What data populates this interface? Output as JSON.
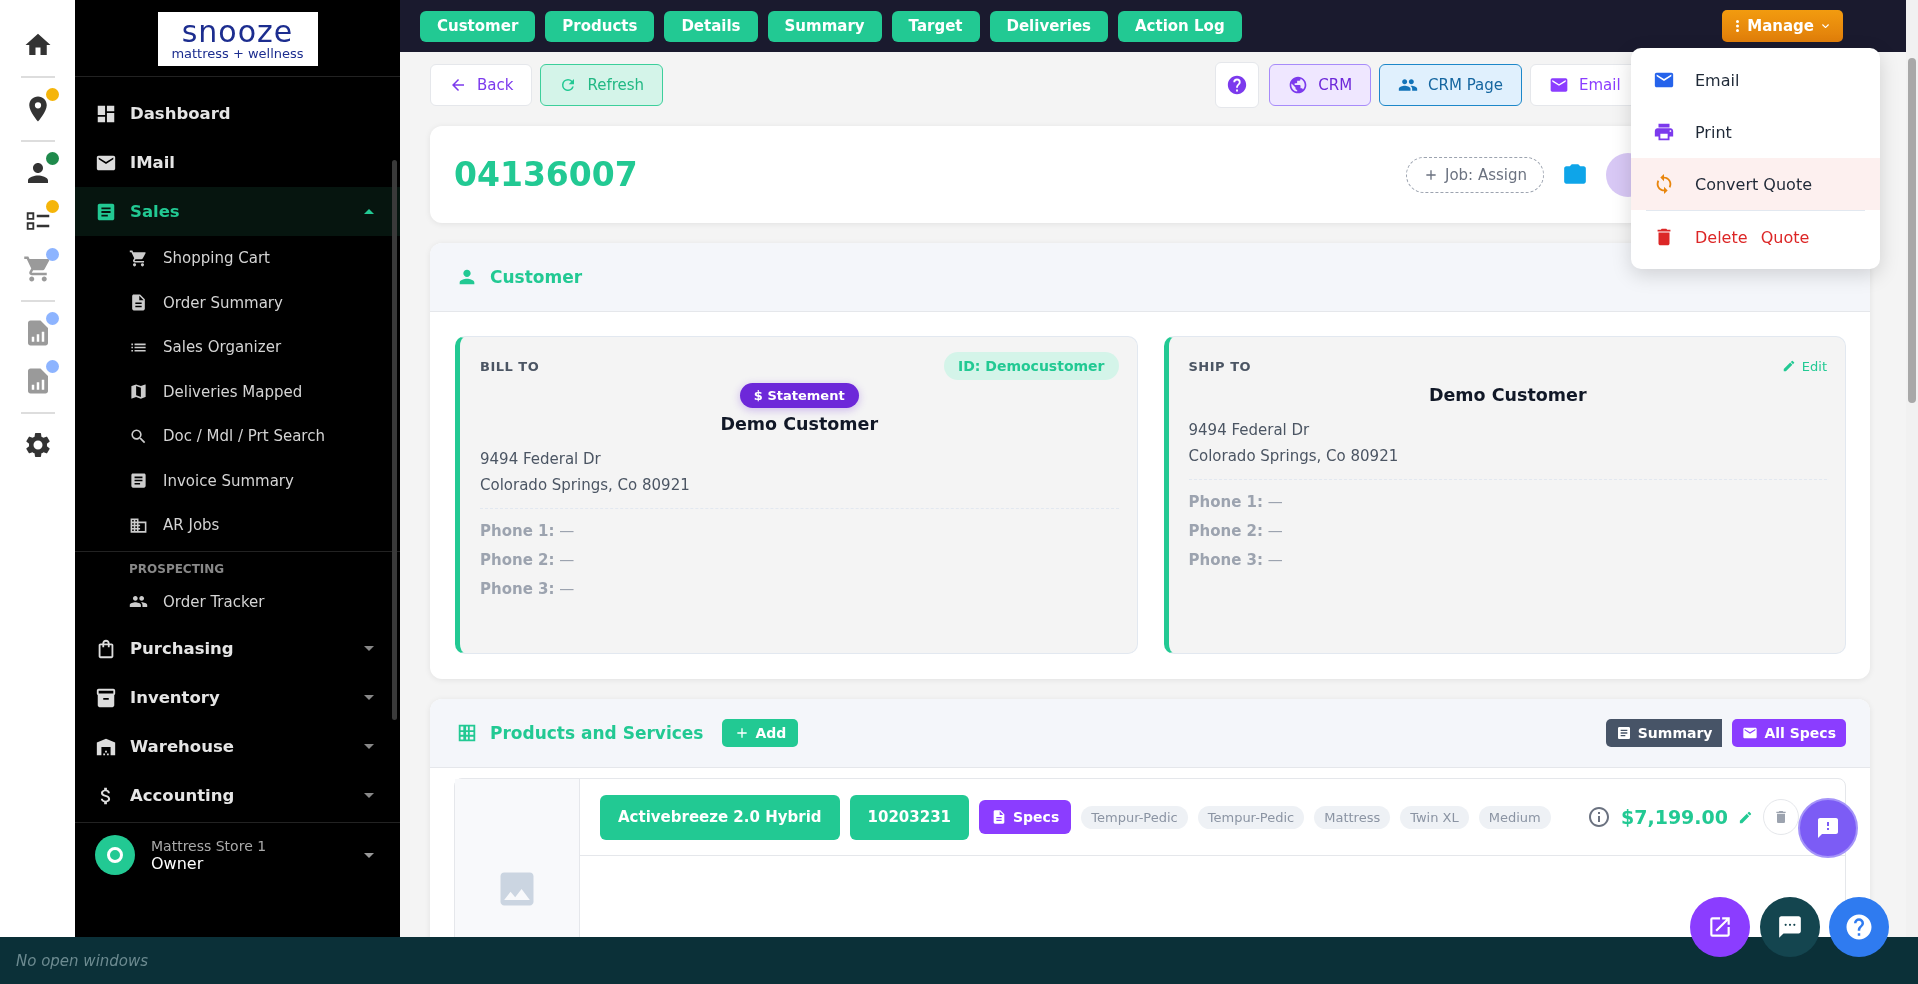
{
  "logo": {
    "name": "snooze",
    "tagline": "mattress + wellness"
  },
  "nav": [
    {
      "kind": "link",
      "label": "Dashboard",
      "selected": false
    },
    {
      "kind": "link",
      "label": "IMail",
      "selected": false
    },
    {
      "kind": "group",
      "label": "Sales",
      "selected": true,
      "expanded": true,
      "children": [
        {
          "label": "Shopping Cart",
          "selected": false
        },
        {
          "label": "Order Summary",
          "selected": false
        },
        {
          "label": "Sales Organizer",
          "selected": false
        },
        {
          "label": "Deliveries Mapped",
          "selected": false
        },
        {
          "label": "Doc / Mdl / Prt Search",
          "selected": false
        },
        {
          "label": "Invoice Summary",
          "selected": false
        },
        {
          "label": "AR Jobs",
          "selected": false
        }
      ],
      "sections": [
        {
          "heading": "PROSPECTING",
          "children": [
            {
              "label": "Order Tracker",
              "selected": false
            }
          ]
        }
      ]
    },
    {
      "kind": "group",
      "label": "Purchasing",
      "selected": false,
      "expanded": false
    },
    {
      "kind": "group",
      "label": "Inventory",
      "selected": false,
      "expanded": false
    },
    {
      "kind": "group",
      "label": "Warehouse",
      "selected": false,
      "expanded": false
    },
    {
      "kind": "group",
      "label": "Accounting",
      "selected": false,
      "expanded": false
    }
  ],
  "user": {
    "store": "Mattress Store 1",
    "role": "Owner"
  },
  "top_tabs": [
    "Customer",
    "Products",
    "Details",
    "Summary",
    "Target",
    "Deliveries",
    "Action Log"
  ],
  "manage_button": "Manage",
  "manage_menu": [
    {
      "kind": "email",
      "label": "Email",
      "highlighted": false
    },
    {
      "kind": "print",
      "label": "Print",
      "highlighted": false
    },
    {
      "kind": "convert",
      "label": "Convert Quote",
      "highlighted": true
    },
    {
      "kind": "delete",
      "label": "Delete Quote",
      "highlighted": false
    }
  ],
  "toolbar": {
    "back": "Back",
    "refresh": "Refresh",
    "crm": "CRM",
    "crm_page": "CRM Page",
    "email": "Email"
  },
  "header": {
    "quote_number": "04136007",
    "job": "Job:  Assign"
  },
  "customer": {
    "title": "Customer",
    "bill_to": {
      "label": "BILL TO",
      "id_badge": "ID: Democustomer",
      "statement": "$ Statement",
      "name": "Demo Customer",
      "address": [
        "9494 Federal Dr",
        "Colorado Springs, Co 80921"
      ],
      "phones": [
        "**Phone 1:** —",
        "**Phone 2:** —",
        "**Phone 3:** —"
      ]
    },
    "ship_to": {
      "label": "SHIP TO",
      "edit": "Edit",
      "name": "Demo Customer",
      "address": [
        "9494 Federal Dr",
        "Colorado Springs, Co 80921"
      ],
      "phones": [
        "**Phone 1:** —",
        "**Phone 2:** —",
        "**Phone 3:** —"
      ]
    }
  },
  "products": {
    "title": "Products and Services",
    "add": "Add",
    "summary": "Summary",
    "all_specs": "All Specs",
    "lines": [
      {
        "name": "Activebreeze 2.0 Hybrid",
        "sku": "10203231",
        "specs": "Specs",
        "tags": [
          "Tempur-Pedic",
          "Tempur-Pedic",
          "Mattress",
          "Twin XL",
          "Medium"
        ],
        "price": "$7,199.00"
      }
    ]
  },
  "status_bar": "No open windows"
}
